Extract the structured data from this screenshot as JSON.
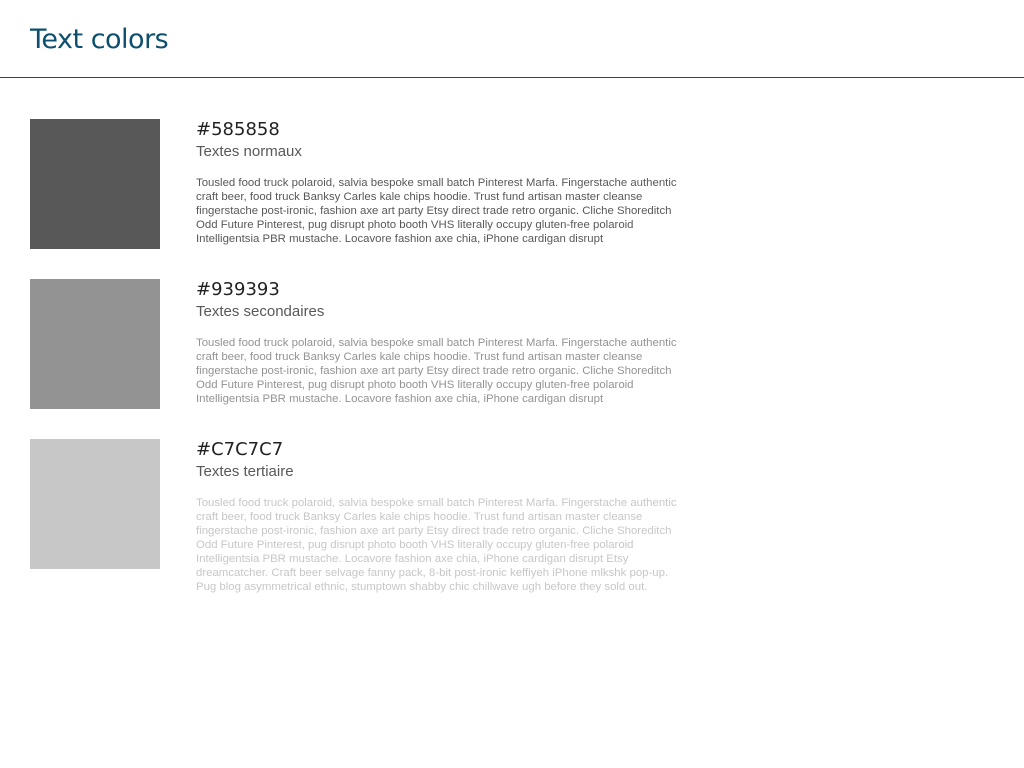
{
  "header": {
    "title": "Text colors"
  },
  "swatches": [
    {
      "hex": "#585858",
      "label": "Textes normaux",
      "sample": "Tousled food truck polaroid, salvia bespoke small batch Pinterest Marfa. Fingerstache authentic craft beer, food truck Banksy Carles kale chips hoodie. Trust fund artisan master cleanse fingerstache post-ironic, fashion axe art party Etsy direct trade retro organic. Cliche Shoreditch Odd Future Pinterest, pug disrupt photo booth VHS literally occupy gluten-free polaroid Intelligentsia PBR mustache. Locavore fashion axe chia, iPhone cardigan disrupt"
    },
    {
      "hex": "#939393",
      "label": "Textes secondaires",
      "sample": "Tousled food truck polaroid, salvia bespoke small batch Pinterest Marfa. Fingerstache authentic craft beer, food truck Banksy Carles kale chips hoodie. Trust fund artisan master cleanse fingerstache post-ironic, fashion axe art party Etsy direct trade retro organic. Cliche Shoreditch Odd Future Pinterest, pug disrupt photo booth VHS literally occupy gluten-free polaroid Intelligentsia PBR mustache. Locavore fashion axe chia, iPhone cardigan disrupt"
    },
    {
      "hex": "#C7C7C7",
      "label": "Textes tertiaire",
      "sample": "Tousled food truck polaroid, salvia bespoke small batch Pinterest Marfa. Fingerstache authentic craft beer, food truck Banksy Carles kale chips hoodie. Trust fund artisan master cleanse fingerstache post-ironic, fashion axe art party Etsy direct trade retro organic. Cliche Shoreditch Odd Future Pinterest, pug disrupt photo booth VHS literally occupy gluten-free polaroid Intelligentsia PBR mustache. Locavore fashion axe chia, iPhone cardigan disrupt Etsy dreamcatcher. Craft beer selvage fanny pack, 8-bit post-ironic keffiyeh iPhone mlkshk pop-up. Pug blog asymmetrical ethnic, stumptown shabby chic chillwave ugh before they sold out."
    }
  ]
}
